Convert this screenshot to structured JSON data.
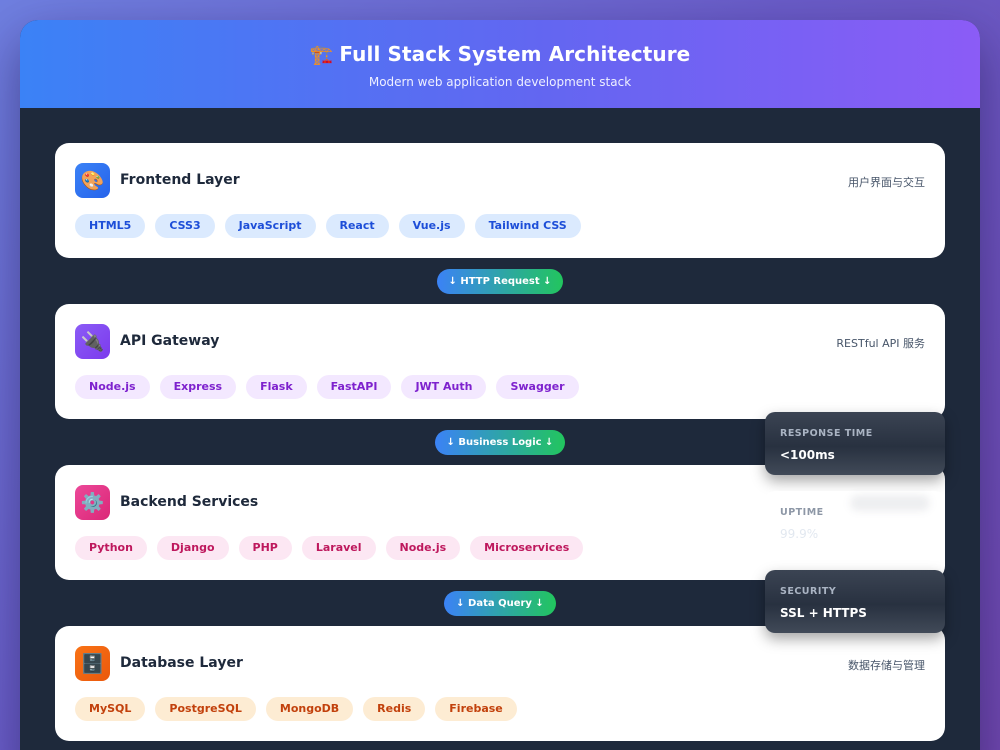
{
  "header": {
    "icon": "🏗️",
    "title": "Full Stack System Architecture",
    "subtitle": "Modern web application development stack"
  },
  "layers": [
    {
      "icon": "🎨",
      "icon_name": "palette-icon",
      "title": "Frontend Layer",
      "desc": "用户界面与交互",
      "gradient": [
        "#3b82f6",
        "#2563eb"
      ],
      "tags": [
        "HTML5",
        "CSS3",
        "JavaScript",
        "React",
        "Vue.js",
        "Tailwind CSS"
      ]
    },
    {
      "icon": "🔌",
      "icon_name": "plug-icon",
      "title": "API Gateway",
      "desc": "RESTful API 服务",
      "gradient": [
        "#8b5cf6",
        "#7c3aed"
      ],
      "tags": [
        "Node.js",
        "Express",
        "Flask",
        "FastAPI",
        "JWT Auth",
        "Swagger"
      ]
    },
    {
      "icon": "⚙️",
      "icon_name": "gear-icon",
      "title": "Backend Services",
      "desc": "",
      "gradient": [
        "#ec4899",
        "#db2777"
      ],
      "tags": [
        "Python",
        "Django",
        "PHP",
        "Laravel",
        "Node.js",
        "Microservices"
      ]
    },
    {
      "icon": "🗄️",
      "icon_name": "cabinet-icon",
      "title": "Database Layer",
      "desc": "数据存储与管理",
      "gradient": [
        "#f97316",
        "#ea580c"
      ],
      "tags": [
        "MySQL",
        "PostgreSQL",
        "MongoDB",
        "Redis",
        "Firebase"
      ]
    }
  ],
  "connectors": [
    "↓ HTTP Request ↓",
    "↓ Business Logic ↓",
    "↓ Data Query ↓"
  ],
  "metrics": [
    {
      "label": "RESPONSE TIME",
      "value": "<100ms"
    },
    {
      "label": "UPTIME",
      "value": "99.9%"
    },
    {
      "label": "SECURITY",
      "value": "SSL + HTTPS"
    }
  ]
}
